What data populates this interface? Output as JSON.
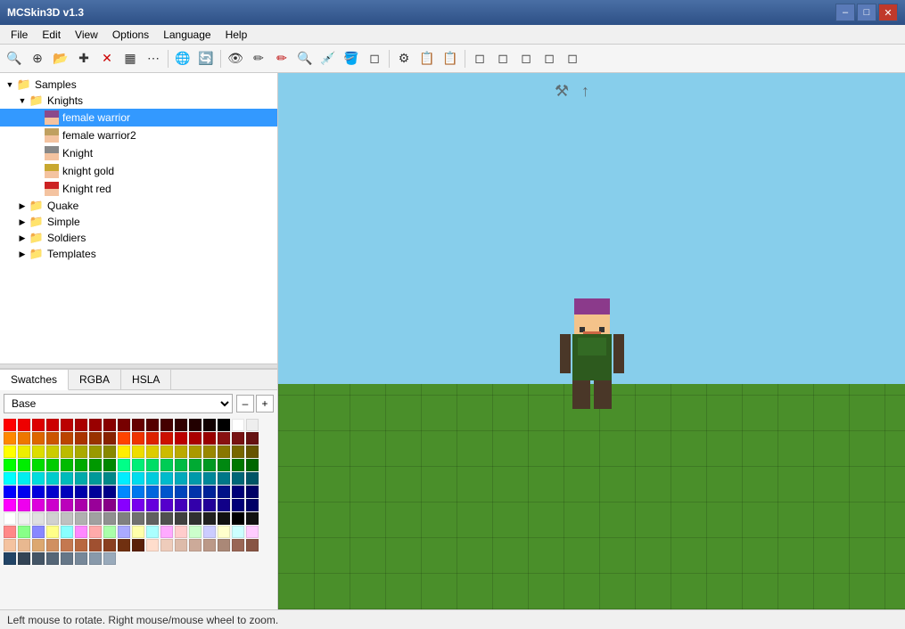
{
  "window": {
    "title": "MCSkin3D v1.3"
  },
  "titlebar": {
    "title": "MCSkin3D v1.3",
    "minimize": "–",
    "maximize": "□",
    "close": "✕"
  },
  "menu": {
    "items": [
      "File",
      "Edit",
      "View",
      "Options",
      "Language",
      "Help"
    ]
  },
  "toolbar": {
    "buttons": [
      "🔍",
      "⊕",
      "📂",
      "✚",
      "✕",
      "▦",
      "⋯",
      "🌐",
      "🔄",
      "👁",
      "✏",
      "✏",
      "🔍",
      "⊕",
      "🔒",
      "🖌",
      "◼",
      "⚙",
      "📋",
      "📋",
      "◻",
      "◻",
      "◻",
      "◻",
      "◻"
    ]
  },
  "filetree": {
    "samples_label": "Samples",
    "knights_label": "Knights",
    "items": [
      {
        "label": "female warrior",
        "selected": true,
        "depth": 3
      },
      {
        "label": "female warrior2",
        "selected": false,
        "depth": 3
      },
      {
        "label": "Knight",
        "selected": false,
        "depth": 3
      },
      {
        "label": "knight gold",
        "selected": false,
        "depth": 3
      },
      {
        "label": "Knight red",
        "selected": false,
        "depth": 3
      }
    ],
    "folders": [
      {
        "label": "Quake",
        "depth": 1
      },
      {
        "label": "Simple",
        "depth": 1
      },
      {
        "label": "Soldiers",
        "depth": 1
      },
      {
        "label": "Templates",
        "depth": 1
      }
    ]
  },
  "swatches": {
    "tab_swatches": "Swatches",
    "tab_rgba": "RGBA",
    "tab_hsla": "HSLA",
    "dropdown_label": "Base",
    "zoom_in": "+",
    "zoom_out": "–"
  },
  "viewport": {
    "status": "Left mouse to rotate. Right mouse/mouse wheel to zoom."
  },
  "colors": {
    "sky": "#87ceeb",
    "ground": "#4a8f2a",
    "selected_bg": "#3399ff"
  }
}
